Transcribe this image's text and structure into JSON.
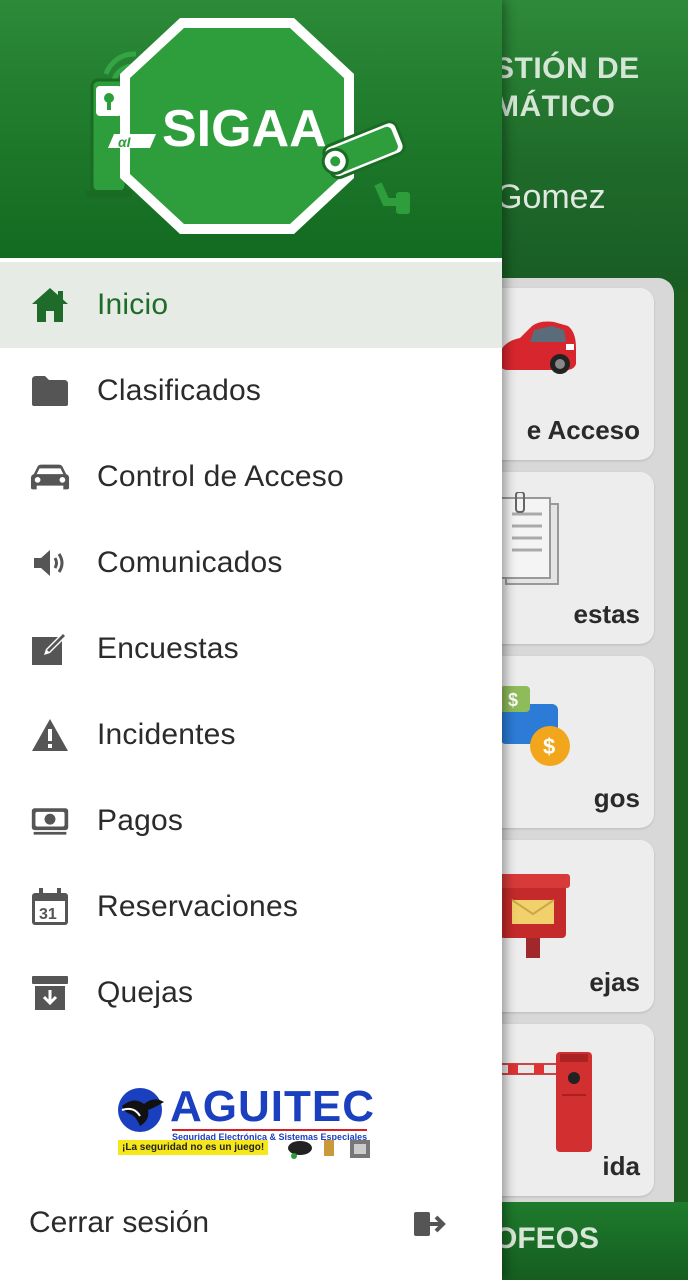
{
  "background": {
    "title_line1": "STIÓN DE",
    "title_line2": "MÁTICO",
    "user": "Gomez",
    "cards": [
      {
        "label": "e Acceso",
        "icon": "car-icon"
      },
      {
        "label": "estas",
        "icon": "survey-icon"
      },
      {
        "label": "gos",
        "icon": "payments-icon"
      },
      {
        "label": "ejas",
        "icon": "mailbox-icon"
      },
      {
        "label": "ida",
        "icon": "barrier-icon"
      }
    ],
    "footer_label": "OFEOS"
  },
  "drawer": {
    "logo_text": "SIGAA",
    "menu": [
      {
        "label": "Inicio",
        "icon": "home-icon",
        "active": true
      },
      {
        "label": "Clasificados",
        "icon": "folder-icon"
      },
      {
        "label": "Control de Acceso",
        "icon": "car-icon"
      },
      {
        "label": "Comunicados",
        "icon": "speaker-icon"
      },
      {
        "label": "Encuestas",
        "icon": "edit-icon"
      },
      {
        "label": "Incidentes",
        "icon": "warning-icon"
      },
      {
        "label": "Pagos",
        "icon": "money-icon"
      },
      {
        "label": "Reservaciones",
        "icon": "calendar-icon",
        "calendar_day": "31"
      },
      {
        "label": "Quejas",
        "icon": "archive-icon"
      }
    ],
    "sponsor": {
      "name": "AGUITEC",
      "tagline": "Seguridad Electrónica & Sistemas Especiales",
      "slogan": "¡La seguridad no es un juego!"
    },
    "logout_label": "Cerrar sesión"
  },
  "colors": {
    "brand_green": "#1f7a2c",
    "active_bg": "#e6ebe6",
    "icon_grey": "#555555"
  }
}
